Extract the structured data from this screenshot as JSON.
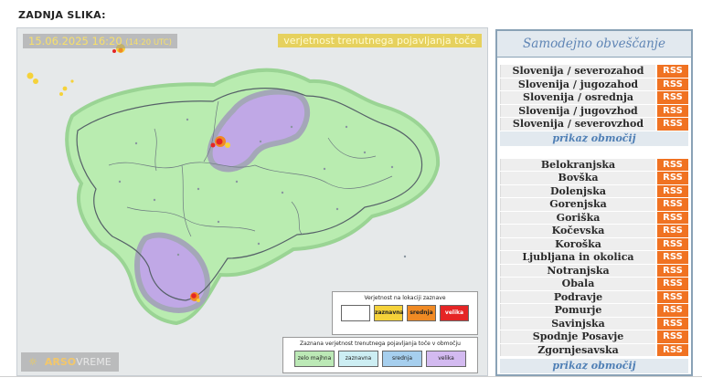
{
  "page": {
    "heading": "ZADNJA SLIKA:"
  },
  "map": {
    "datetime": "15.06.2025 16:20",
    "utc_time": "(14:20 UTC)",
    "title": "verjetnost trenutnega pojavljanja toče",
    "logo": {
      "sun_icon": "sun-icon",
      "arso": "ARSO",
      "vreme": "VREME"
    },
    "legend_location": {
      "title": "Verjetnost na lokaciji zaznave",
      "items": [
        {
          "label": "",
          "color": "#ffffff"
        },
        {
          "label": "zaznavna",
          "color": "#f5d23a"
        },
        {
          "label": "srednja",
          "color": "#f08a24"
        },
        {
          "label": "velika",
          "color": "#e52525"
        }
      ]
    },
    "legend_area": {
      "title": "Zaznana verjetnost trenutnega pojavljanja toče v območju",
      "items": [
        {
          "label": "zelo majhna",
          "color": "#bce9b6"
        },
        {
          "label": "zaznavna",
          "color": "#cdeef3"
        },
        {
          "label": "srednja",
          "color": "#a6cfee"
        },
        {
          "label": "velika",
          "color": "#d3baf0"
        }
      ]
    },
    "colors": {
      "background": "#e6e9ea",
      "region_fill": "#b4ecaa",
      "purple_zone": "#c19cf0",
      "borders": "#5d6970"
    }
  },
  "panel": {
    "title": "Samodejno obveščanje",
    "rss_label": "RSS",
    "show_regions": "prikaz območij",
    "regions_primary": [
      "Slovenija / severozahod",
      "Slovenija / jugozahod",
      "Slovenija / osrednja",
      "Slovenija / jugovzhod",
      "Slovenija / severovzhod"
    ],
    "regions_secondary": [
      "Belokranjska",
      "Bovška",
      "Dolenjska",
      "Gorenjska",
      "Goriška",
      "Kočevska",
      "Koroška",
      "Ljubljana in okolica",
      "Notranjska",
      "Obala",
      "Podravje",
      "Pomurje",
      "Savinjska",
      "Spodnje Posavje",
      "Zgornjesavska"
    ],
    "colors": {
      "rss": "#f07222",
      "header_text": "#5f85b5",
      "border": "#8aa2b6"
    }
  }
}
